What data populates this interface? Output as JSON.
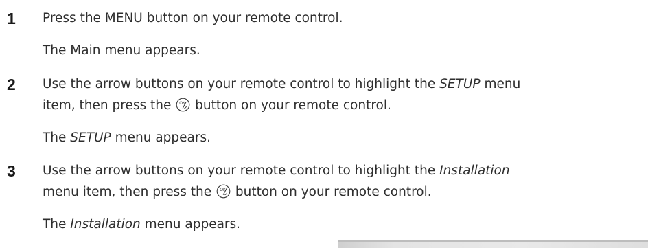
{
  "steps": [
    {
      "number": "1",
      "lines": [
        {
          "text": "Press the MENU button on your remote control."
        },
        {
          "text": "The Main menu appears."
        }
      ]
    },
    {
      "number": "2",
      "line1": {
        "pre": "Use the arrow buttons on your remote control to highlight the ",
        "em": "SETUP",
        "post": " menu"
      },
      "line2": {
        "pre": "item, then press the ",
        "post": " button on your remote control."
      },
      "result": {
        "em": "SETUP",
        "post": " menu appears.",
        "pre": "The "
      }
    },
    {
      "number": "3",
      "line1": {
        "pre": "Use the arrow buttons on your remote control to highlight the ",
        "em": "Installation"
      },
      "line2": {
        "pre": "menu item, then press the ",
        "post": " button on your remote control."
      },
      "result": {
        "pre": "The ",
        "em": "Installation",
        "post": " menu appears."
      }
    }
  ],
  "icons": {
    "ok_button": "ok-button-icon"
  }
}
